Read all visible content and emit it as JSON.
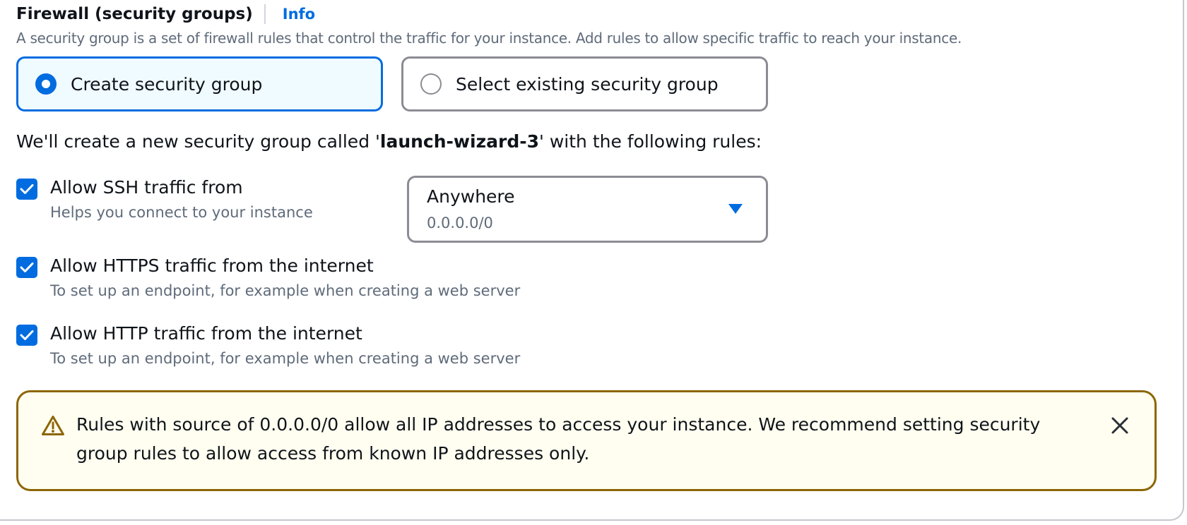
{
  "section": {
    "title": "Firewall (security groups)",
    "info_link": "Info",
    "description": "A security group is a set of firewall rules that control the traffic for your instance. Add rules to allow specific traffic to reach your instance."
  },
  "tiles": [
    {
      "label": "Create security group",
      "selected": true
    },
    {
      "label": "Select existing security group",
      "selected": false
    }
  ],
  "note": {
    "prefix": "We'll create a new security group called '",
    "group_name": "launch-wizard-3",
    "suffix": "' with the following rules:"
  },
  "rules": [
    {
      "label": "Allow SSH traffic from",
      "description": "Helps you connect to your instance",
      "checked": true
    },
    {
      "label": "Allow HTTPS traffic from the internet",
      "description": "To set up an endpoint, for example when creating a web server",
      "checked": true
    },
    {
      "label": "Allow HTTP traffic from the internet",
      "description": "To set up an endpoint, for example when creating a web server",
      "checked": true
    }
  ],
  "ssh_source_select": {
    "value": "Anywhere",
    "sub_value": "0.0.0.0/0"
  },
  "alert": {
    "message": "Rules with source of 0.0.0.0/0 allow all IP addresses to access your instance. We recommend setting security group rules to allow access from known IP addresses only.",
    "icon": "warning-icon",
    "close_icon": "close-icon"
  },
  "colors": {
    "accent": "#006ce0",
    "warning_border": "#8d6605",
    "warning_bg": "#fffef0"
  }
}
